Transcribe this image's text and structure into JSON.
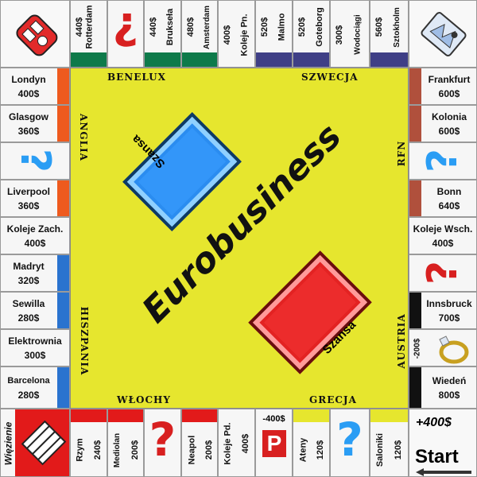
{
  "board": {
    "title": "Eurobusiness",
    "regions": {
      "benelux": "BENELUX",
      "szwecja": "SZWECJA",
      "anglia": "ANGLIA",
      "rfn": "RFN",
      "hiszpania": "HISZPANIA",
      "austria": "AUSTRIA",
      "wlochy": "WŁOCHY",
      "grecja": "GRECJA"
    },
    "chance_label": "Szansa",
    "colors": {
      "board": "#e6e62e",
      "chance_blue": "#2a8cf0",
      "chance_red": "#e32222",
      "question_red": "#d82020",
      "question_blue": "#2a9df4",
      "green": "#0e7a4a",
      "navy": "#3f3f86",
      "orange": "#ee5a1e",
      "brown": "#b0503c",
      "blue": "#2a73cf",
      "black": "#111111",
      "red": "#e21a1a",
      "yellow": "#e6e62e"
    }
  },
  "top": [
    {
      "name": "Rotterdam",
      "price": "440$",
      "color": "#0e7a4a"
    },
    {
      "question": "?",
      "color": "#d82020"
    },
    {
      "name": "Brukseła",
      "price": "440$",
      "color": "#0e7a4a"
    },
    {
      "name": "Amsterdam",
      "price": "480$",
      "color": "#0e7a4a"
    },
    {
      "name": "Koleje Pn.",
      "price": "400$"
    },
    {
      "name": "Malmo",
      "price": "520$",
      "color": "#3f3f86"
    },
    {
      "name": "Goteborg",
      "price": "520$",
      "color": "#3f3f86"
    },
    {
      "name": "Wodociągi",
      "price": "300$"
    },
    {
      "name": "Sztokholm",
      "price": "560$",
      "color": "#3f3f86"
    }
  ],
  "left": [
    {
      "name": "Londyn",
      "price": "400$",
      "color": "#ee5a1e"
    },
    {
      "name": "Glasgow",
      "price": "360$",
      "color": "#ee5a1e"
    },
    {
      "question": "?",
      "color": "#2a9df4"
    },
    {
      "name": "Liverpool",
      "price": "360$",
      "color": "#ee5a1e"
    },
    {
      "name": "Koleje Zach.",
      "price": "400$"
    },
    {
      "name": "Madryt",
      "price": "320$",
      "color": "#2a73cf"
    },
    {
      "name": "Sewilla",
      "price": "280$",
      "color": "#2a73cf"
    },
    {
      "name": "Elektrownia",
      "price": "300$"
    },
    {
      "name": "Barcelona",
      "price": "280$",
      "color": "#2a73cf"
    }
  ],
  "right": [
    {
      "name": "Frankfurt",
      "price": "600$",
      "color": "#b0503c"
    },
    {
      "name": "Kolonia",
      "price": "600$",
      "color": "#b0503c"
    },
    {
      "question": "?",
      "color": "#2a9df4"
    },
    {
      "name": "Bonn",
      "price": "640$",
      "color": "#b0503c"
    },
    {
      "name": "Koleje Wsch.",
      "price": "400$"
    },
    {
      "question": "?",
      "color": "#d82020"
    },
    {
      "name": "Innsbruck",
      "price": "700$",
      "color": "#111111"
    },
    {
      "tax": "-200$"
    },
    {
      "name": "Wiedeń",
      "price": "800$",
      "color": "#111111"
    }
  ],
  "bottom": [
    {
      "name": "Rzym",
      "price": "240$",
      "color": "#e21a1a"
    },
    {
      "name": "Mediolan",
      "price": "200$",
      "color": "#e21a1a"
    },
    {
      "question": "?",
      "color": "#d82020"
    },
    {
      "name": "Neapol",
      "price": "200$",
      "color": "#e21a1a"
    },
    {
      "name": "Koleje Pd.",
      "price": "400$"
    },
    {
      "parking": "P",
      "tax": "-400$"
    },
    {
      "name": "Ateny",
      "price": "120$",
      "color": "#e6e62e"
    },
    {
      "question": "?",
      "color": "#2a9df4"
    },
    {
      "name": "Saloniki",
      "price": "120$",
      "color": "#e6e62e"
    }
  ],
  "corners": {
    "jail": "Więzienie",
    "start": "Start",
    "start_bonus": "+400$"
  }
}
